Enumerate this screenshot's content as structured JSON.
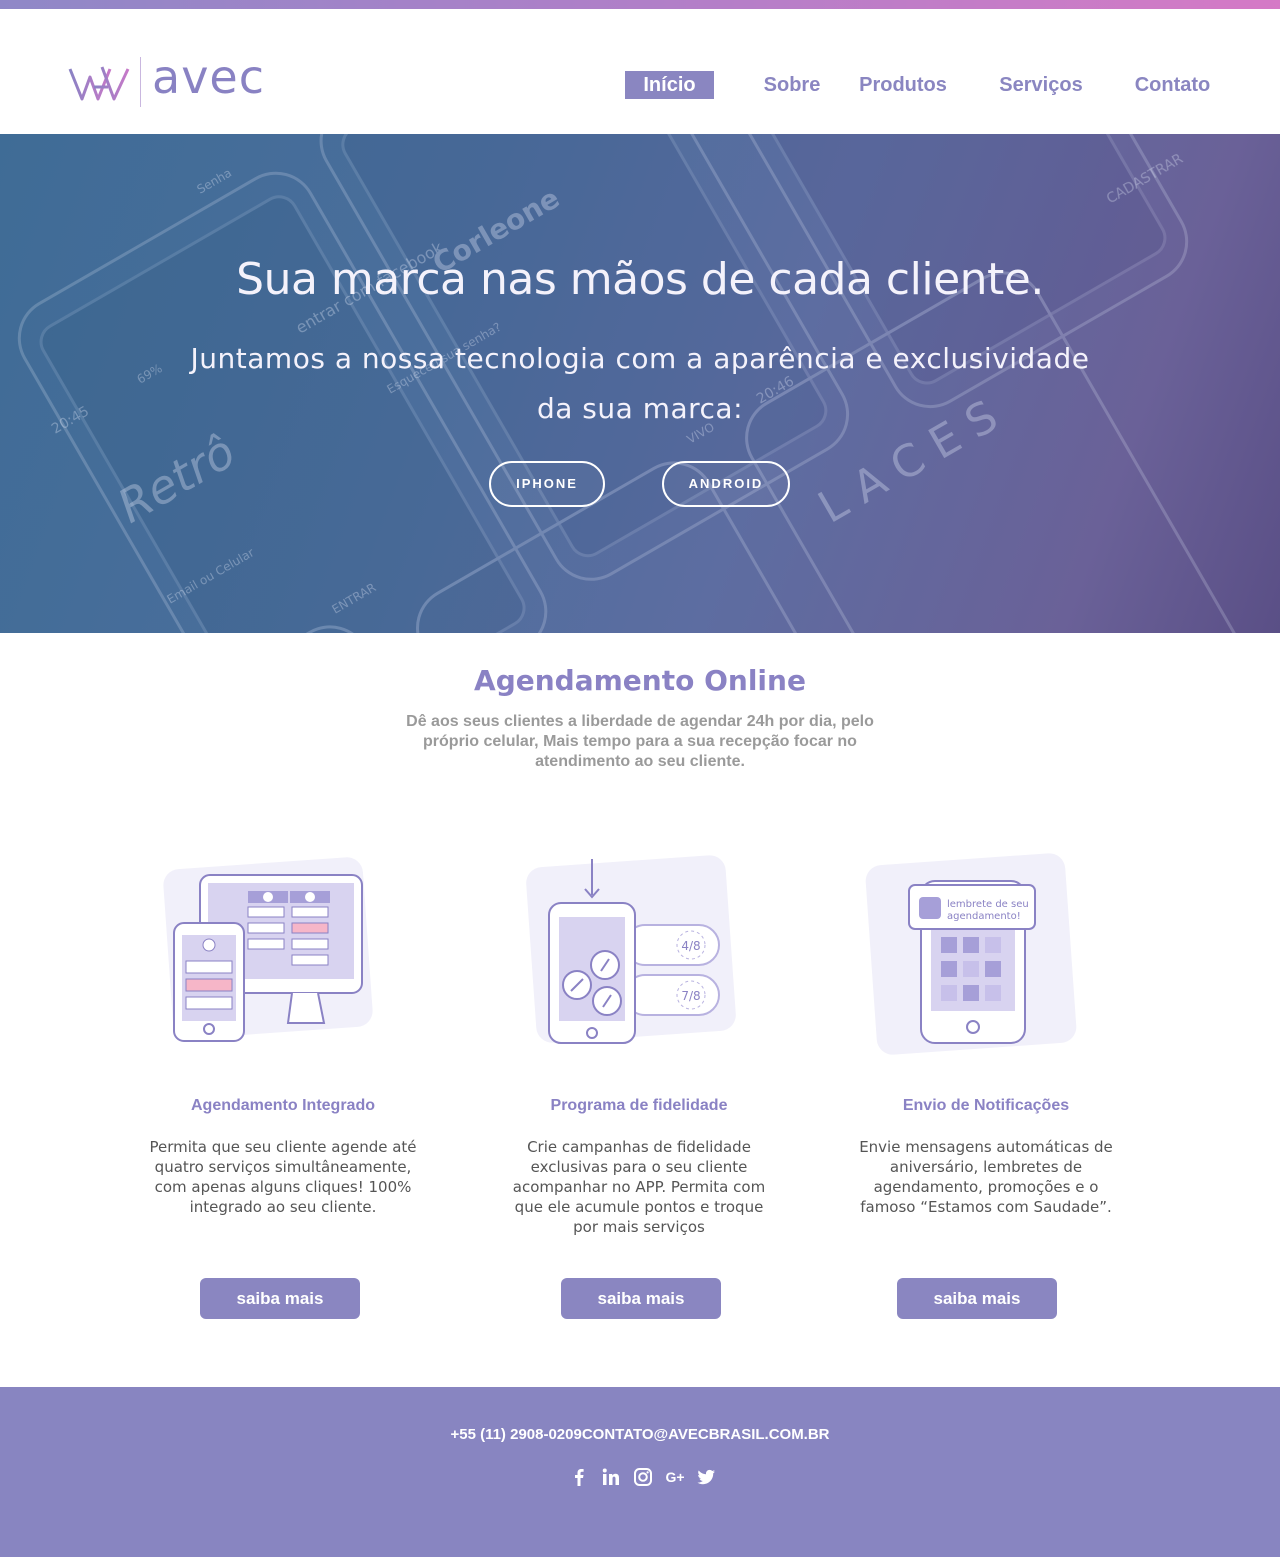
{
  "brand": {
    "name": "avec",
    "accent": "#8a86c1",
    "gradient_start": "#8f88c7",
    "gradient_end": "#d57ac6"
  },
  "nav": {
    "items": [
      {
        "label": "Início",
        "active": true
      },
      {
        "label": "Sobre",
        "active": false
      },
      {
        "label": "Produtos",
        "active": false
      },
      {
        "label": "Serviços",
        "active": false
      },
      {
        "label": "Contato",
        "active": false
      }
    ]
  },
  "hero": {
    "title": "Sua marca nas mãos de cada cliente.",
    "subtitle_line1": "Juntamos a nossa tecnologia com a aparência e exclusividade",
    "subtitle_line2": "da sua marca:",
    "buttons": {
      "iphone": "IPHONE",
      "android": "ANDROID"
    },
    "mockup_text": [
      "entrar com facebook",
      "Senha",
      "Esqueceu sua senha?",
      "Corleone",
      "20:45",
      "69%",
      "Retrô",
      "Email ou Celular",
      "ENTRAR",
      "20:46",
      "VIVO",
      "LACES",
      "CADASTRAR"
    ]
  },
  "section": {
    "title": "Agendamento Online",
    "subtitle": "Dê aos seus clientes a liberdade de agendar 24h por dia, pelo próprio celular, Mais tempo para a sua recepção focar no atendimento ao seu cliente."
  },
  "features": [
    {
      "title": "Agendamento Integrado",
      "text": "Permita que seu cliente agende até quatro serviços simultâneamente, com apenas alguns cliques! 100% integrado ao seu cliente.",
      "button": "saiba mais",
      "icon": "devices-schedule-illustration"
    },
    {
      "title": "Programa de fidelidade",
      "text": "Crie campanhas de fidelidade exclusivas para o seu cliente acompanhar no APP. Permita com que ele acumule pontos e troque por mais serviços",
      "button": "saiba mais",
      "icon": "loyalty-coins-illustration",
      "card_labels": [
        "4/8",
        "7/8"
      ]
    },
    {
      "title": "Envio de Notificações",
      "text": "Envie mensagens automáticas de aniversário, lembretes de agendamento, promoções e o famoso “Estamos com Saudade”.",
      "button": "saiba mais",
      "icon": "notification-phone-illustration",
      "notification_line1": "lembrete de seu",
      "notification_line2": "agendamento!"
    }
  ],
  "footer": {
    "phone": "+55 (11) 2908-0209",
    "email": "CONTATO@AVECBRASIL.COM.BR",
    "social": [
      "facebook-icon",
      "linkedin-icon",
      "instagram-icon",
      "google-plus-icon",
      "twitter-icon"
    ],
    "google_plus_label": "G+"
  }
}
